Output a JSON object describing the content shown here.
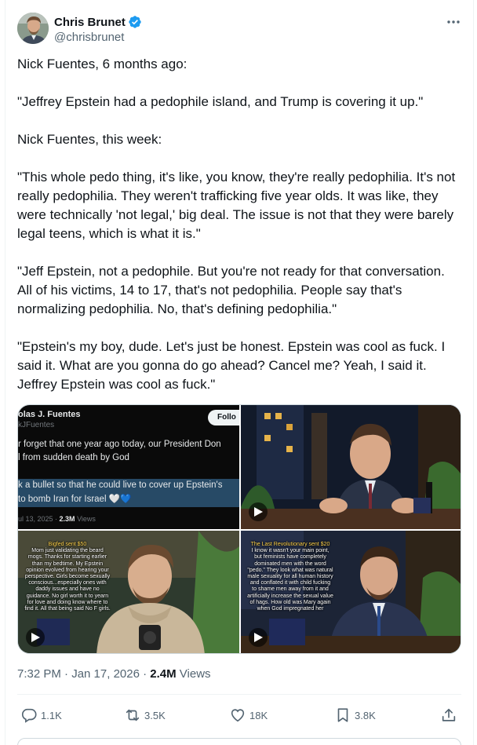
{
  "author": {
    "display_name": "Chris Brunet",
    "handle": "@chrisbrunet",
    "verified": true,
    "avatar_icon": "profile-photo"
  },
  "tweet": {
    "paragraphs": [
      "Nick Fuentes, 6 months ago:",
      "\"Jeffrey Epstein had a pedophile island, and Trump is covering it up.\"",
      "Nick Fuentes, this week:",
      "\"This whole pedo thing, it's like, you know, they're really pedophilia.  It's not really pedophilia. They weren't trafficking five year olds. It was like, they were technically 'not legal,' big deal. The issue is not that they were barely legal teens, which is what it is.\"",
      "\"Jeff Epstein, not a pedophile. But you're not ready for that conversation. All of his victims, 14 to 17, that's not pedophilia. People say that's normalizing pedophilia. No, that's defining pedophilia.\"",
      "\"Epstein's my boy, dude. Let's just be honest. Epstein was cool as fuck. I said it. What are you gonna do go ahead? Cancel me? Yeah, I said it. Jeffrey Epstein was cool as fuck.\""
    ]
  },
  "media": {
    "screenshot_tile": {
      "name": "olas J. Fuentes",
      "handle": "kJFuentes",
      "follow_label": "Follo",
      "lines": [
        "r forget that one year ago today, our President Don",
        "l from sudden death by God"
      ],
      "highlight_lines": [
        "k a bullet so that he could live to cover up Epstein's",
        "to bomb Iran for Israel 🤍💙"
      ],
      "date": "ul 13, 2025 · ",
      "views_count": "2.3M",
      "views_label": " Views"
    },
    "video_tile_3_caption": {
      "donor": "Bigfed sent $50",
      "text": "Mom just validating the beard mogs. Thanks for starting earlier than my bedtime. My Epstein opinion evolved from hearing your perspective. Girls become sexually conscious...especially ones with daddy issues and have no guidance. No girl worth it to yearn for love and doing know where to find it. All that being said No F girls."
    },
    "video_tile_4_caption": {
      "donor": "The Last Revolutionary sent $20",
      "text": "I know it wasn't your main point, but feminists have completely dominated men with the word \"pedo.\" They look what was natural male sexuality for all human history and conflated it with child fucking to shame men away from it and artificially increase the sexual value of hags. How old was Mary again when God impregnated her"
    }
  },
  "meta": {
    "time": "7:32 PM · Jan 17, 2026 · ",
    "views_count": "2.4M",
    "views_label": " Views"
  },
  "actions": {
    "reply_count": "1.1K",
    "repost_count": "3.5K",
    "like_count": "18K",
    "bookmark_count": "3.8K"
  },
  "colors": {
    "verified_badge": "#1d9bf0",
    "text_secondary": "#536471",
    "text_primary": "#0f1419"
  }
}
